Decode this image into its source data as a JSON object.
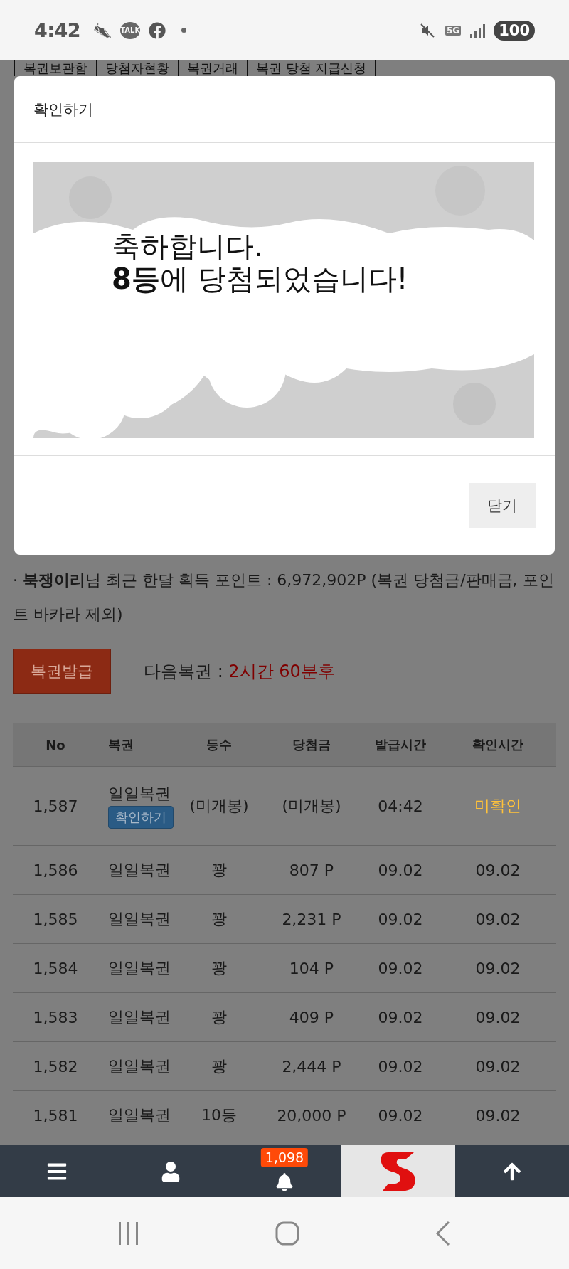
{
  "status_bar": {
    "time": "4:42",
    "chat_logo": "TALK",
    "network": "5G",
    "battery": "100"
  },
  "page_tabs": [
    "복권보관함",
    "당첨자현황",
    "복권거래",
    "복권 당첨 지급신청"
  ],
  "modal": {
    "title": "확인하기",
    "message": [
      "축하합니다.",
      "**8등**에 당첨되었습니다!"
    ],
    "close_button": "닫기"
  },
  "points_notice": "· **북쟁이리**님 최근 한달 획득 포인트 : 6,972,902P (복권 당첨금/판매금, 포인트 바카라 제외)",
  "issue_button": "복권발급",
  "next_ticket": {
    "label": "다음복권 :",
    "value": "2시간 60분후"
  },
  "table": {
    "columns": [
      "No",
      "복권",
      "등수",
      "당첨금",
      "발급시간",
      "확인시간"
    ],
    "rows": [
      {
        "no": "1,587",
        "ticket": "일일복권",
        "action": "확인하기",
        "rank": "(미개봉)",
        "prize": "(미개봉)",
        "issued": "04:42",
        "checked": "미확인",
        "confirmed": false
      },
      {
        "no": "1,586",
        "ticket": "일일복권",
        "rank": "꽝",
        "prize": "807 P",
        "issued": "09.02",
        "checked": "09.02",
        "confirmed": true
      },
      {
        "no": "1,585",
        "ticket": "일일복권",
        "rank": "꽝",
        "prize": "2,231 P",
        "issued": "09.02",
        "checked": "09.02",
        "confirmed": true
      },
      {
        "no": "1,584",
        "ticket": "일일복권",
        "rank": "꽝",
        "prize": "104 P",
        "issued": "09.02",
        "checked": "09.02",
        "confirmed": true
      },
      {
        "no": "1,583",
        "ticket": "일일복권",
        "rank": "꽝",
        "prize": "409 P",
        "issued": "09.02",
        "checked": "09.02",
        "confirmed": true
      },
      {
        "no": "1,582",
        "ticket": "일일복권",
        "rank": "꽝",
        "prize": "2,444 P",
        "issued": "09.02",
        "checked": "09.02",
        "confirmed": true
      },
      {
        "no": "1,581",
        "ticket": "일일복권",
        "rank": "10등",
        "prize": "20,000 P",
        "issued": "09.02",
        "checked": "09.02",
        "confirmed": true
      }
    ]
  },
  "bottom_nav": {
    "items": [
      {
        "kind": "menu"
      },
      {
        "kind": "user"
      },
      {
        "kind": "bell",
        "badge": "1,098"
      },
      {
        "kind": "logo"
      },
      {
        "kind": "top"
      }
    ]
  }
}
